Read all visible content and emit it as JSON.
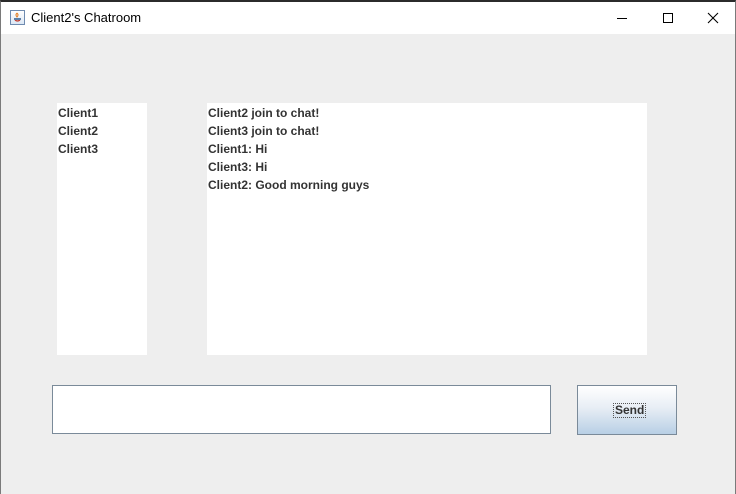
{
  "window": {
    "title": "Client2's Chatroom",
    "controls": [
      "minimize-icon",
      "maximize-icon",
      "close-icon"
    ]
  },
  "users": {
    "items": [
      "Client1",
      "Client2",
      "Client3"
    ]
  },
  "chat": {
    "lines": [
      "Client2 join to chat!",
      "Client3 join to chat!",
      "Client1: Hi",
      "Client3: Hi",
      "Client2: Good morning guys"
    ]
  },
  "composer": {
    "input_value": "",
    "send_label": "Send"
  },
  "colors": {
    "background": "#eeeeee",
    "panel": "#ffffff",
    "text": "#333333",
    "button_gradient_end": "#b8cfe5"
  }
}
